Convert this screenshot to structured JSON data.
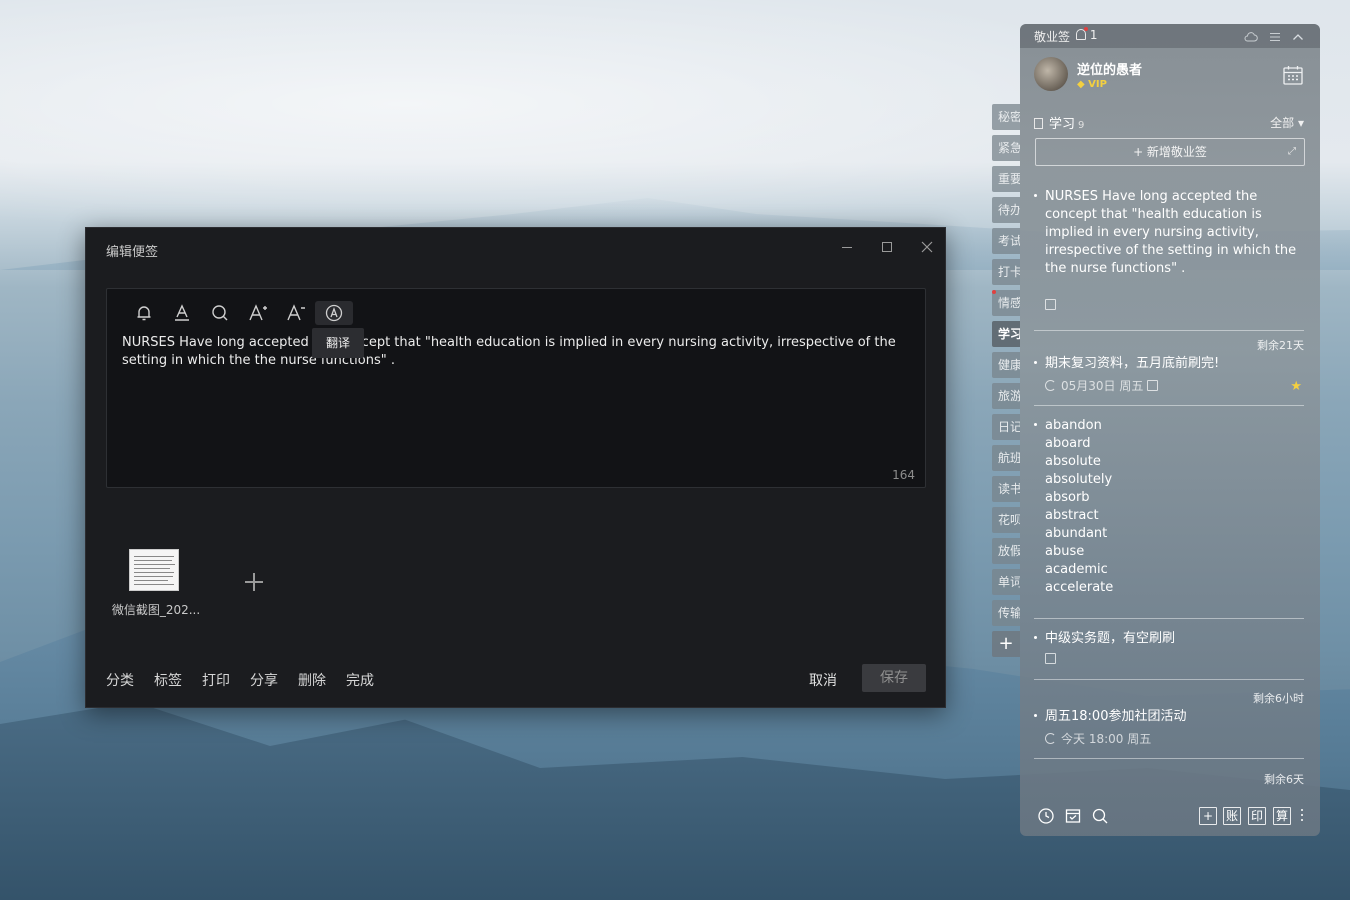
{
  "editor": {
    "title": "编辑便签",
    "tooltip": "翻译",
    "note_text": "NURSES Have long accepted the concept that \"health education is implied in every nursing activity, irrespective of the setting in which the the nurse functions\" .",
    "char_count": "164",
    "toolbar_icons": [
      "bell-icon",
      "font-color-icon",
      "search-icon",
      "font-increase-icon",
      "font-decrease-icon",
      "translate-icon"
    ],
    "attachment_name": "微信截图_202...",
    "actions": [
      "分类",
      "标签",
      "打印",
      "分享",
      "删除",
      "完成"
    ],
    "cancel_label": "取消",
    "save_label": "保存"
  },
  "category_tabs": [
    "秘密",
    "紧急",
    "重要",
    "待办",
    "考试",
    "打卡",
    "情感",
    "学习",
    "健康",
    "旅游",
    "日记",
    "航班",
    "读书",
    "花呗",
    "放假",
    "单词",
    "传输"
  ],
  "active_tab": "学习",
  "panel": {
    "app_title": "敬业签",
    "notification_count": "1",
    "username": "逆位的愚者",
    "vip_label": "VIP",
    "category": "学习",
    "category_count": "9",
    "filter_label": "全部",
    "new_note_label": "+ 新增敬业签",
    "notes": [
      {
        "text": "NURSES Have long accepted the concept that \"health education is implied in every nursing activity, irrespective of the setting in which the the nurse functions\" .",
        "remain": "剩余21天"
      },
      {
        "text": "期末复习资料，五月底前刷完!",
        "meta": "05月30日 周五"
      },
      {
        "words": [
          "abandon",
          "aboard",
          "absolute",
          "absolutely",
          "absorb",
          "abstract",
          "abundant",
          "abuse",
          "academic",
          "accelerate"
        ]
      },
      {
        "text": "中级实务题，有空刷刷",
        "remain": "剩余6小时"
      },
      {
        "text": "周五18:00参加社团活动",
        "meta": "今天 18:00 周五",
        "remain": "剩余6天"
      }
    ],
    "bottom_buttons": [
      "账",
      "印",
      "算"
    ]
  }
}
